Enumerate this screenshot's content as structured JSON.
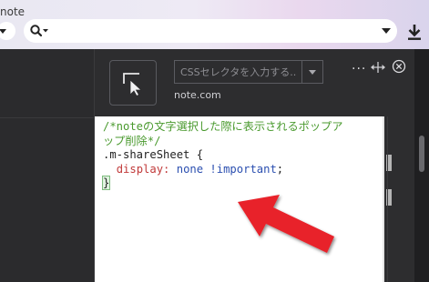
{
  "browser": {
    "tab_title": "note",
    "search_placeholder": ""
  },
  "popup": {
    "selector_placeholder": "CSSセレクタを入力する...",
    "host": "note.com",
    "more_label": "···"
  },
  "editor": {
    "comment_line1": "/*noteの文字選択した際に表示されるポップア",
    "comment_line2": "ップ削除*/",
    "selector": ".m-shareSheet {",
    "property": "display:",
    "value": "none !important",
    "semicolon": ";",
    "close_brace": "}"
  },
  "colors": {
    "annotation_arrow": "#e8212b",
    "comment": "#4a9a2e",
    "property": "#c13a3a",
    "value": "#2b4fb0"
  }
}
